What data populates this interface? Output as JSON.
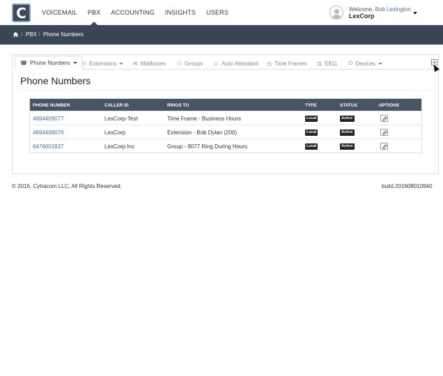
{
  "logo": {
    "letter": "C"
  },
  "nav": {
    "items": [
      {
        "label": "VOICEMAIL"
      },
      {
        "label": "PBX"
      },
      {
        "label": "ACCOUNTING"
      },
      {
        "label": "INSIGHTS"
      },
      {
        "label": "USERS"
      }
    ],
    "active": "PBX"
  },
  "user": {
    "welcome_prefix": "Welcome, ",
    "name": "Bob Lexington",
    "company": "LexCorp"
  },
  "breadcrumb": {
    "items": [
      {
        "label": "PBX"
      },
      {
        "label": "Phone Numbers"
      }
    ]
  },
  "tabs": [
    {
      "label": "Phone Numbers",
      "icon": "phone-icon",
      "glyph": "☎"
    },
    {
      "label": "Extensions",
      "icon": "users-icon",
      "glyph": "⚇"
    },
    {
      "label": "Mailboxes",
      "icon": "envelope-icon",
      "glyph": "✉"
    },
    {
      "label": "Groups",
      "icon": "group-icon",
      "glyph": "⚇"
    },
    {
      "label": "Auto Attendant",
      "icon": "user-icon",
      "glyph": "☺"
    },
    {
      "label": "Time Frames",
      "icon": "clock-icon",
      "glyph": "◷"
    },
    {
      "label": "E911",
      "icon": "ambulance-icon",
      "glyph": "⚖"
    },
    {
      "label": "Devices",
      "icon": "power-icon",
      "glyph": "⏻"
    }
  ],
  "main": {
    "title": "Phone Numbers"
  },
  "table": {
    "columns": [
      "PHONE NUMBER",
      "CALLER ID",
      "RINGS TO",
      "TYPE",
      "STATUS",
      "OPTIONS"
    ],
    "rows": [
      {
        "phone": "4694409077",
        "caller_id": "LexCorp-Test",
        "rings_to": "Time Frame - Business Hours",
        "type": "Local",
        "status": "Active"
      },
      {
        "phone": "4694409078",
        "caller_id": "LexCorp",
        "rings_to": "Extension - Bob Dylan (200)",
        "type": "Local",
        "status": "Active"
      },
      {
        "phone": "6476601837",
        "caller_id": "LexCorp Inc",
        "rings_to": "Group - 9077 Ring During Hours",
        "type": "Local",
        "status": "Active"
      }
    ]
  },
  "footer": {
    "copyright": "© 2016, Cytracom LLC. All Rights Reserved.",
    "build": "build.201608010940"
  },
  "colors": {
    "header_bar": "#3b4654",
    "table_header": "#4a5363",
    "link": "#4a6a94"
  }
}
